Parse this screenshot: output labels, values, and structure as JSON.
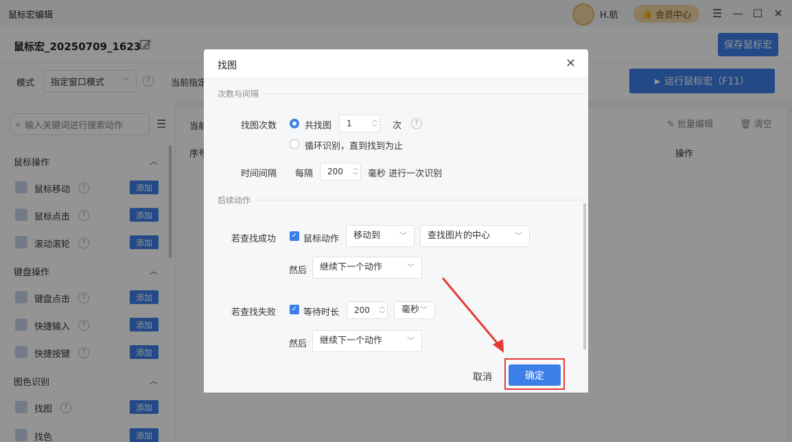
{
  "window": {
    "title": "鼠标宏编辑",
    "username": "H.航",
    "vip_label": "会员中心",
    "win_buttons": [
      "☰",
      "—",
      "☐",
      "✕"
    ]
  },
  "header": {
    "macro_name": "鼠标宏_20250709_1623",
    "save_label": "保存鼠标宏"
  },
  "modebar": {
    "mode_label": "模式",
    "mode_value": "指定窗口模式",
    "current_label": "当前指定",
    "run_label": "运行鼠标宏（F11）"
  },
  "sidebar": {
    "search_placeholder": "输入关键词进行搜索动作",
    "sections": [
      {
        "title": "鼠标操作",
        "items": [
          {
            "label": "鼠标移动",
            "add": "添加"
          },
          {
            "label": "鼠标点击",
            "add": "添加"
          },
          {
            "label": "滚动滚轮",
            "add": "添加"
          }
        ]
      },
      {
        "title": "键盘操作",
        "items": [
          {
            "label": "键盘点击",
            "add": "添加"
          },
          {
            "label": "快捷输入",
            "add": "添加"
          },
          {
            "label": "快捷按键",
            "add": "添加"
          }
        ]
      },
      {
        "title": "图色识别",
        "items": [
          {
            "label": "找图",
            "add": "添加"
          },
          {
            "label": "找色",
            "add": "添加"
          }
        ]
      }
    ]
  },
  "main": {
    "current_label": "当前",
    "col_index": "序号",
    "col_action": "操作",
    "batch_edit": "批量编辑",
    "clear": "清空"
  },
  "dialog": {
    "title": "找图",
    "group1": "次数与间隔",
    "find_count_label": "找图次数",
    "opt_total_label": "共找图",
    "total_value": "1",
    "times_unit": "次",
    "opt_loop_label": "循环识别，直到找到为止",
    "interval_label": "时间间隔",
    "every_label": "每隔",
    "interval_value": "200",
    "interval_suffix": "毫秒 进行一次识别",
    "group2": "后续动作",
    "success_label": "若查找成功",
    "mouse_action_label": "鼠标动作",
    "move_to_value": "移动到",
    "target_value": "查找图片的中心",
    "then_label": "然后",
    "then_success_value": "继续下一个动作",
    "fail_label": "若查找失败",
    "wait_label": "等待时长",
    "wait_value": "200",
    "wait_unit": "毫秒",
    "then_fail_value": "继续下一个动作",
    "cancel_label": "取消",
    "ok_label": "确定"
  }
}
